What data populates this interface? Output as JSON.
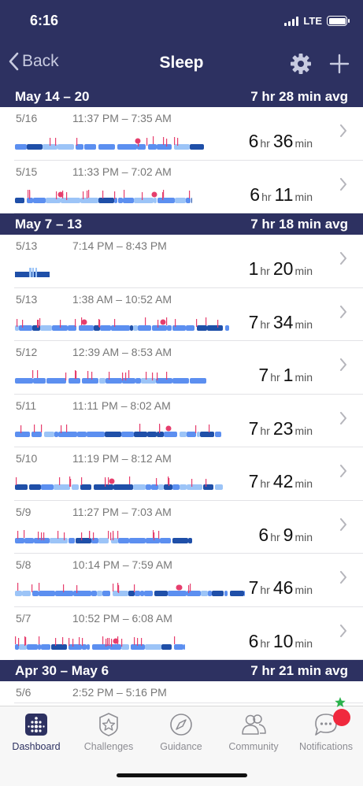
{
  "status_bar": {
    "time": "6:16",
    "network": "LTE"
  },
  "nav": {
    "back_label": "Back",
    "title": "Sleep",
    "settings_icon": "gear-icon",
    "add_icon": "plus-icon"
  },
  "colors": {
    "header_bg": "#2d3161",
    "deep": "#1f4fa8",
    "light": "#5c8ff0",
    "rem": "#9cc4f7",
    "awake": "#e63e6d"
  },
  "weeks": [
    {
      "range": "May 14 – 20",
      "avg": "7 hr 28 min avg",
      "entries": [
        {
          "date": "5/16",
          "times": "11:37 PM – 7:35 AM",
          "hours": "6",
          "minutes": "36",
          "hr_unit": "hr",
          "min_unit": "min"
        },
        {
          "date": "5/15",
          "times": "11:33 PM – 7:02 AM",
          "hours": "6",
          "minutes": "11",
          "hr_unit": "hr",
          "min_unit": "min"
        }
      ]
    },
    {
      "range": "May 7 – 13",
      "avg": "7 hr 18 min avg",
      "entries": [
        {
          "date": "5/13",
          "times": "7:14 PM – 8:43 PM",
          "hours": "1",
          "minutes": "20",
          "hr_unit": "hr",
          "min_unit": "min"
        },
        {
          "date": "5/13",
          "times": "1:38 AM – 10:52 AM",
          "hours": "7",
          "minutes": "34",
          "hr_unit": "hr",
          "min_unit": "min"
        },
        {
          "date": "5/12",
          "times": "12:39 AM – 8:53 AM",
          "hours": "7",
          "minutes": "1",
          "hr_unit": "hr",
          "min_unit": "min"
        },
        {
          "date": "5/11",
          "times": "11:11 PM – 8:02 AM",
          "hours": "7",
          "minutes": "23",
          "hr_unit": "hr",
          "min_unit": "min"
        },
        {
          "date": "5/10",
          "times": "11:19 PM – 8:12 AM",
          "hours": "7",
          "minutes": "42",
          "hr_unit": "hr",
          "min_unit": "min"
        },
        {
          "date": "5/9",
          "times": "11:27 PM – 7:03 AM",
          "hours": "6",
          "minutes": "9",
          "hr_unit": "hr",
          "min_unit": "min"
        },
        {
          "date": "5/8",
          "times": "10:14 PM – 7:59 AM",
          "hours": "7",
          "minutes": "46",
          "hr_unit": "hr",
          "min_unit": "min"
        },
        {
          "date": "5/7",
          "times": "10:52 PM – 6:08 AM",
          "hours": "6",
          "minutes": "10",
          "hr_unit": "hr",
          "min_unit": "min"
        }
      ]
    },
    {
      "range": "Apr 30 – May 6",
      "avg": "7 hr 21 min avg",
      "entries": [
        {
          "date": "5/6",
          "times": "2:52 PM – 5:16 PM"
        }
      ]
    }
  ],
  "tabs": [
    {
      "label": "Dashboard",
      "icon": "dashboard-grid-icon",
      "active": true
    },
    {
      "label": "Challenges",
      "icon": "star-badge-icon",
      "active": false
    },
    {
      "label": "Guidance",
      "icon": "compass-icon",
      "active": false
    },
    {
      "label": "Community",
      "icon": "people-icon",
      "active": false
    },
    {
      "label": "Notifications",
      "icon": "chat-bubble-icon",
      "active": false
    }
  ]
}
